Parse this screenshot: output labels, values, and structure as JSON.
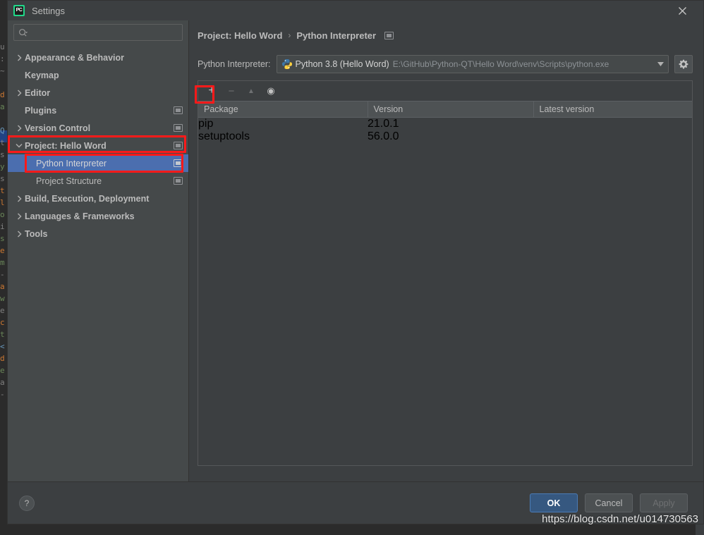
{
  "window": {
    "title": "Settings",
    "logo_icon": "pycharm-logo-icon",
    "logo_text": "PC",
    "close_icon": "close-icon"
  },
  "search": {
    "value": "",
    "placeholder": "",
    "icon": "search-icon"
  },
  "sidebar": {
    "items": [
      {
        "label": "Appearance & Behavior",
        "depth": 0,
        "arrow": "chevron-right",
        "bold": true,
        "modified": false,
        "selected": false
      },
      {
        "label": "Keymap",
        "depth": 0,
        "arrow": "",
        "bold": true,
        "modified": false,
        "selected": false
      },
      {
        "label": "Editor",
        "depth": 0,
        "arrow": "chevron-right",
        "bold": true,
        "modified": false,
        "selected": false
      },
      {
        "label": "Plugins",
        "depth": 0,
        "arrow": "",
        "bold": true,
        "modified": true,
        "selected": false
      },
      {
        "label": "Version Control",
        "depth": 0,
        "arrow": "chevron-right",
        "bold": true,
        "modified": true,
        "selected": false
      },
      {
        "label": "Project: Hello Word",
        "depth": 0,
        "arrow": "chevron-down",
        "bold": true,
        "modified": true,
        "selected": false
      },
      {
        "label": "Python Interpreter",
        "depth": 1,
        "arrow": "",
        "bold": false,
        "modified": true,
        "selected": true
      },
      {
        "label": "Project Structure",
        "depth": 1,
        "arrow": "",
        "bold": false,
        "modified": true,
        "selected": false
      },
      {
        "label": "Build, Execution, Deployment",
        "depth": 0,
        "arrow": "chevron-right",
        "bold": true,
        "modified": false,
        "selected": false
      },
      {
        "label": "Languages & Frameworks",
        "depth": 0,
        "arrow": "chevron-right",
        "bold": true,
        "modified": false,
        "selected": false
      },
      {
        "label": "Tools",
        "depth": 0,
        "arrow": "chevron-right",
        "bold": true,
        "modified": false,
        "selected": false
      }
    ]
  },
  "breadcrumb": {
    "parent": "Project: Hello Word",
    "separator": "›",
    "current": "Python Interpreter",
    "modified_icon": "modified-settings-icon"
  },
  "interpreter": {
    "label": "Python Interpreter:",
    "icon": "python-icon",
    "name": "Python 3.8 (Hello Word)",
    "path": "E:\\GitHub\\Python-QT\\Hello Word\\venv\\Scripts\\python.exe",
    "dropdown_icon": "chevron-down-icon",
    "gear_icon": "gear-icon"
  },
  "packages": {
    "toolbar": [
      {
        "name": "add-package-button",
        "glyph": "+",
        "disabled": false,
        "highlighted": true
      },
      {
        "name": "remove-package-button",
        "glyph": "−",
        "disabled": true,
        "highlighted": false
      },
      {
        "name": "upgrade-package-button",
        "glyph": "▲",
        "disabled": true,
        "highlighted": false
      },
      {
        "name": "show-early-releases-button",
        "glyph": "◉",
        "disabled": false,
        "highlighted": false
      }
    ],
    "columns": [
      "Package",
      "Version",
      "Latest version"
    ],
    "rows": [
      {
        "package": "pip",
        "version": "21.0.1",
        "latest": ""
      },
      {
        "package": "setuptools",
        "version": "56.0.0",
        "latest": ""
      }
    ]
  },
  "footer": {
    "help_label": "?",
    "ok_label": "OK",
    "cancel_label": "Cancel",
    "apply_label": "Apply"
  },
  "annotations": {
    "color": "#ff1a1a",
    "boxes": [
      "project-hello-word-row-highlight",
      "python-interpreter-row-highlight",
      "add-package-button-highlight"
    ]
  },
  "watermark": {
    "text": "https://blog.csdn.net/u014730563"
  },
  "colors": {
    "dialog_bg": "#3c3f41",
    "sidebar_bg": "#45494a",
    "selection_blue": "#4b6eaf",
    "ok_button_blue": "#365880",
    "annotation_red": "#ff1a1a",
    "text": "#bbbbbb"
  },
  "background_editor": {
    "lines": [
      "u",
      "d",
      "a",
      "Q",
      "t",
      "s",
      "y",
      "s",
      "t",
      "l",
      "o",
      "i",
      "s",
      "e",
      "m",
      "-",
      "a",
      "w",
      "e",
      "c",
      "t",
      "<",
      "d",
      "e",
      "a",
      "-"
    ]
  }
}
